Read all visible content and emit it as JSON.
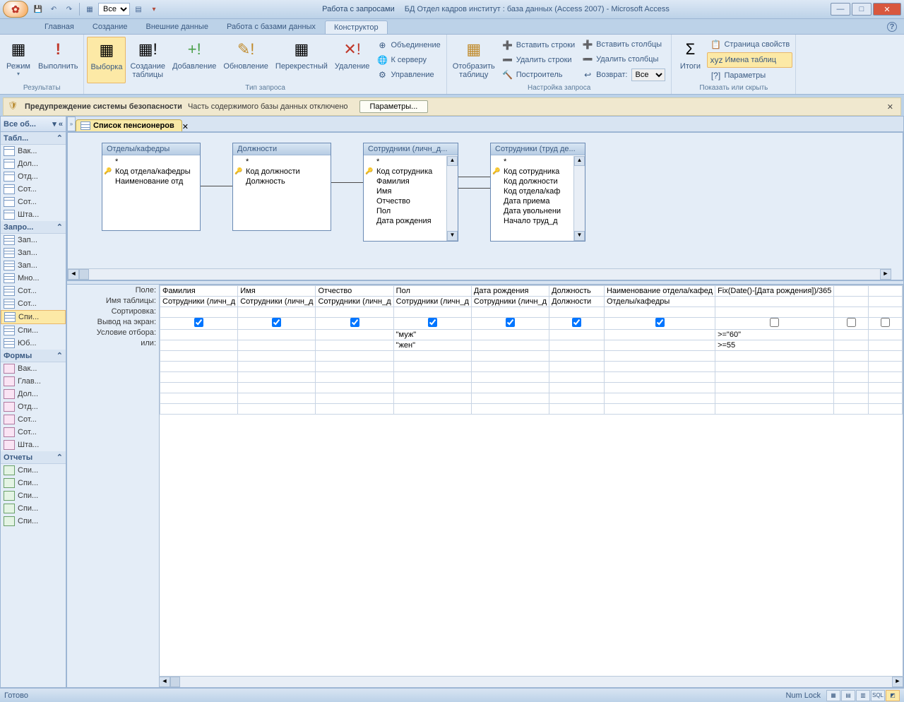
{
  "title": {
    "context": "Работа с запросами",
    "db": "БД Отдел кадров институт : база данных (Access 2007) - Microsoft Access"
  },
  "qat": {
    "dropdown": "Все"
  },
  "tabs": {
    "home": "Главная",
    "create": "Создание",
    "external": "Внешние данные",
    "dbtools": "Работа с базами данных",
    "design": "Конструктор"
  },
  "ribbon": {
    "results": {
      "view": "Режим",
      "run": "Выполнить",
      "label": "Результаты"
    },
    "qtype": {
      "select": "Выборка",
      "maketable": "Создание\nтаблицы",
      "append": "Добавление",
      "update": "Обновление",
      "crosstab": "Перекрестный",
      "delete": "Удаление",
      "union": "Объединение",
      "passthrough": "К серверу",
      "ddl": "Управление",
      "label": "Тип запроса"
    },
    "setup": {
      "showtable": "Отобразить\nтаблицу",
      "insrows": "Вставить строки",
      "delrows": "Удалить строки",
      "builder": "Построитель",
      "inscols": "Вставить столбцы",
      "delcols": "Удалить столбцы",
      "returnlbl": "Возврат:",
      "returnval": "Все",
      "label": "Настройка запроса"
    },
    "showhide": {
      "totals": "Итоги",
      "propsheet": "Страница свойств",
      "tablenames": "Имена таблиц",
      "params": "Параметры",
      "label": "Показать или скрыть"
    }
  },
  "security": {
    "heading": "Предупреждение системы безопасности",
    "text": "Часть содержимого базы данных отключено",
    "btn": "Параметры..."
  },
  "nav": {
    "title": "Все об...",
    "g_tables": "Табл...",
    "tables": [
      "Вак...",
      "Дол...",
      "Отд...",
      "Сот...",
      "Сот...",
      "Шта..."
    ],
    "g_queries": "Запро...",
    "queries": [
      "Зап...",
      "Зап...",
      "Зап...",
      "Мно...",
      "Сот...",
      "Сот...",
      "Спи...",
      "Спи...",
      "Юб..."
    ],
    "q_selected": 6,
    "g_forms": "Формы",
    "forms": [
      "Вак...",
      "Глав...",
      "Дол...",
      "Отд...",
      "Сот...",
      "Сот...",
      "Шта..."
    ],
    "g_reports": "Отчеты",
    "reports": [
      "Спи...",
      "Спи...",
      "Спи...",
      "Спи...",
      "Спи..."
    ]
  },
  "doc": {
    "tab": "Список пенсионеров"
  },
  "tables_design": {
    "t1": {
      "title": "Отделы/кафедры",
      "fields": [
        "*",
        "Код отдела/кафедры",
        "Наименование отд"
      ],
      "keys": [
        1
      ]
    },
    "t2": {
      "title": "Должности",
      "fields": [
        "*",
        "Код должности",
        "Должность"
      ],
      "keys": [
        1
      ]
    },
    "t3": {
      "title": "Сотрудники (личн_д...",
      "fields": [
        "*",
        "Код сотрудника",
        "Фамилия",
        "Имя",
        "Отчество",
        "Пол",
        "Дата рождения"
      ],
      "keys": [
        1
      ]
    },
    "t4": {
      "title": "Сотрудники (труд де...",
      "fields": [
        "*",
        "Код сотрудника",
        "Код должности",
        "Код отдела/каф",
        "Дата приема",
        "Дата увольнени",
        "Начало труд_д"
      ],
      "keys": [
        1
      ]
    }
  },
  "grid": {
    "rows": {
      "field": "Поле:",
      "table": "Имя таблицы:",
      "sort": "Сортировка:",
      "show": "Вывод на экран:",
      "criteria": "Условие отбора:",
      "or": "или:"
    },
    "cols": [
      {
        "field": "Фамилия",
        "table": "Сотрудники (личн_д",
        "show": true,
        "criteria": "",
        "or": ""
      },
      {
        "field": "Имя",
        "table": "Сотрудники (личн_д",
        "show": true,
        "criteria": "",
        "or": ""
      },
      {
        "field": "Отчество",
        "table": "Сотрудники (личн_д",
        "show": true,
        "criteria": "",
        "or": ""
      },
      {
        "field": "Пол",
        "table": "Сотрудники (личн_д",
        "show": true,
        "criteria": "\"муж\"",
        "or": "\"жен\""
      },
      {
        "field": "Дата рождения",
        "table": "Сотрудники (личн_д",
        "show": true,
        "criteria": "",
        "or": ""
      },
      {
        "field": "Должность",
        "table": "Должности",
        "show": true,
        "criteria": "",
        "or": ""
      },
      {
        "field": "Наименование отдела/кафед",
        "table": "Отделы/кафедры",
        "show": true,
        "criteria": "",
        "or": ""
      },
      {
        "field": "Fix(Date()-[Дата рождения])/365",
        "table": "",
        "show": false,
        "criteria": ">=\"60\"",
        "or": ">=55"
      }
    ]
  },
  "status": {
    "ready": "Готово",
    "numlock": "Num Lock",
    "sql": "SQL"
  }
}
